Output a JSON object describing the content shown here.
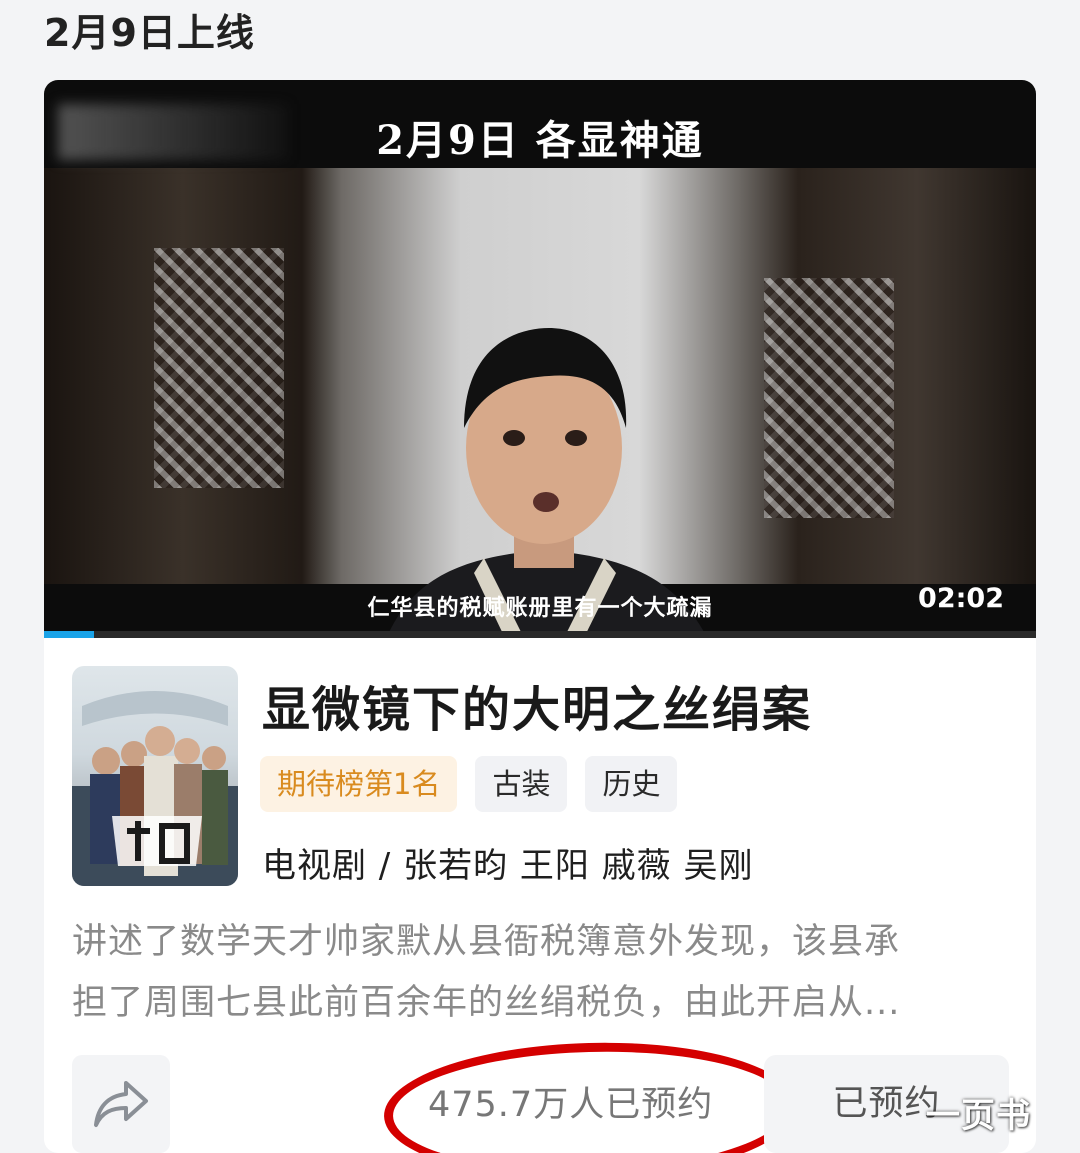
{
  "page": {
    "date_title": "2月9日上线"
  },
  "video": {
    "headline": "2月9日 各显神通",
    "subtitle": "仁华县的税赋账册里有一个大疏漏",
    "duration": "02:02",
    "progress_fraction": 0.05
  },
  "show": {
    "title": "显微镜下的大明之丝绢案",
    "tags": [
      "期待榜第1名",
      "古装",
      "历史"
    ],
    "meta": "电视剧 / 张若昀 王阳 戚薇 吴刚",
    "description_lines": [
      "讲述了数学天才帅家默从县衙税簿意外发现，该县承",
      "担了周围七县此前百余年的丝绢税负，由此开启从..."
    ]
  },
  "actions": {
    "share_icon": "share-arrow-icon",
    "reserve_count": "475.7万人已预约",
    "reserved_label": "已预约"
  },
  "watermark": "一页书",
  "colors": {
    "rank_tag_text": "#d98b1f",
    "rank_tag_bg": "#fdf2e3",
    "progress": "#1aa3e8",
    "annotation_circle": "#d40000"
  }
}
